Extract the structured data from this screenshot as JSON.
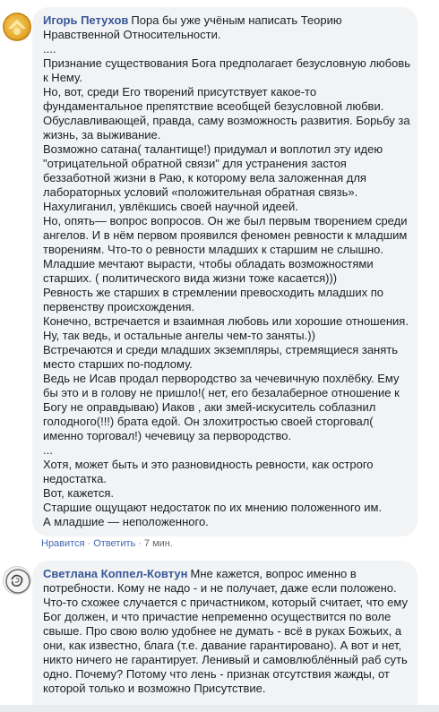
{
  "comments": [
    {
      "author": "Игорь Петухов",
      "first_line_text": "Пора бы уже учёным написать Теорию",
      "lines": [
        "Нравственной Относительности.",
        "....",
        "Признание существования Бога предполагает безусловную любовь",
        "к Нему.",
        "Но, вот, среди Его творений присутствует какое-то",
        "фундаментальное препятствие всеобщей безусловной любви.",
        "Обуславливающей, правда, саму возможность развития. Борьбу за",
        "жизнь, за выживание.",
        "Возможно сатана( талантище!) придумал и воплотил эту идею",
        "\"отрицательной обратной связи\" для устранения застоя",
        "беззаботной жизни в Раю, к которому вела заложенная для",
        "лабораторных условий «положительная обратная связь».",
        "Нахулиганил, увлёкшись своей научной идеей.",
        "Но, опять— вопрос вопросов. Он же был первым творением среди",
        "ангелов. И в нём первом проявился феномен ревности к младшим",
        "творениям. Что-то о ревности младших к старшим не слышно.",
        "Младшие мечтают вырасти, чтобы обладать возможностями",
        "старших. ( политического вида жизни тоже касается)))",
        "Ревность же старших в стремлении превосходить младших по",
        "первенству происхождения.",
        "Конечно, встречается и взаимная любовь или хорошие отношения.",
        "Ну, так ведь, и остальные ангелы чем-то заняты.))",
        "Встречаются и среди младших экземпляры, стремящиеся занять",
        "место старших по-подлому.",
        "Ведь не Исав продал первородство за чечевичную похлёбку. Ему",
        "бы это и в голову не пришло!( нет, его безалаберное отношение к",
        "Богу не оправдываю) Иаков , аки змей-искуситель соблазнил",
        "голодного(!!!) брата едой. Он злохитростью своей сторговал(",
        "именно торговал!) чечевицу за первородство.",
        "...",
        "Хотя, может быть и это разновидность ревности, как острого",
        "недостатка.",
        "Вот, кажется.",
        "Старшие ощущают недостаток по их мнению положенного им.",
        "А младшие — неположенного."
      ],
      "actions": {
        "like": "Нравится",
        "reply": "Ответить",
        "time": "7 мин."
      }
    },
    {
      "author": "Светлана Коппел-Ковтун",
      "first_line_text": "Мне кажется, вопрос именно в",
      "lines": [
        "потребности. Кому не надо - и не получает, даже если положено.",
        "Что-то схожее случается с причастником, который считает, что ему",
        "Бог должен, и что причастие непременно осуществится по воле",
        "свыше. Про свою волю удобнее не думать - всё в руках Божьих, а",
        "они, как известно, блага (т.е. давание гарантировано). А вот и нет,",
        "никто ничего не гарантирует. Ленивый и самовлюблённый раб суть",
        "одно. Почему? Потому что лень - признак отсутствия жажды, от",
        "которой только и возможно Присутствие."
      ]
    }
  ],
  "action_separator": "·",
  "colors": {
    "author_link": "#385898",
    "action_link": "#4267b2",
    "bubble_bg": "#f2f3f5",
    "meta_text": "#606770"
  }
}
